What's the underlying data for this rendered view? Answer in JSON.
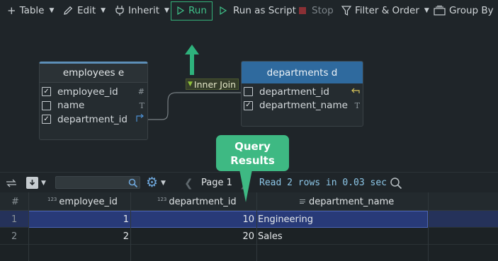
{
  "toolbar": {
    "table_label": "Table",
    "edit_label": "Edit",
    "inherit_label": "Inherit",
    "run_label": "Run",
    "run_script_label": "Run as Script",
    "stop_label": "Stop",
    "filter_label": "Filter & Order",
    "group_label": "Group By"
  },
  "diagram": {
    "employees": {
      "title": "employees e",
      "columns": [
        {
          "name": "employee_id",
          "checked": true,
          "type_icon": "#"
        },
        {
          "name": "name",
          "checked": false,
          "type_icon": "T"
        },
        {
          "name": "department_id",
          "checked": true,
          "type_icon": "join-arrow"
        }
      ]
    },
    "departments": {
      "title": "departments d",
      "columns": [
        {
          "name": "department_id",
          "checked": false,
          "type_icon": "join-arrow"
        },
        {
          "name": "department_name",
          "checked": true,
          "type_icon": "T"
        }
      ]
    },
    "join_label": "Inner Join"
  },
  "callout": {
    "line1": "Query",
    "line2": "Results"
  },
  "results_bar": {
    "page_label": "Page 1",
    "status": "Read 2 rows in 0.03 sec"
  },
  "grid": {
    "columns": [
      {
        "label": "#",
        "badge": ""
      },
      {
        "label": "employee_id",
        "badge": "123"
      },
      {
        "label": "department_id",
        "badge": "123"
      },
      {
        "label": "department_name",
        "badge": "text"
      }
    ],
    "rows": [
      {
        "num": "1",
        "employee_id": "1",
        "department_id": "10",
        "department_name": "Engineering",
        "selected": true
      },
      {
        "num": "2",
        "employee_id": "2",
        "department_id": "20",
        "department_name": "Sales",
        "selected": false
      }
    ]
  },
  "colors": {
    "accent_green": "#3eb983",
    "header_blue": "#2f6a9e",
    "selection": "#283a78"
  }
}
